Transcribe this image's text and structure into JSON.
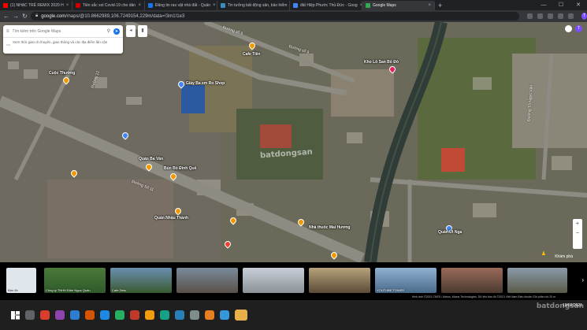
{
  "tabs": [
    {
      "label": "(1) NHẠC TRẺ REMIX 2020 H",
      "color": "#ff0000"
    },
    {
      "label": "Tiền sắc xoi Covid-19 cho dân",
      "color": "#cc0000"
    },
    {
      "label": "Đăng tin rao vặt nhà đất - Quản",
      "color": "#1a73e8"
    },
    {
      "label": "Tin tưởng bất động sản, bảo hiểm",
      "color": "#3c8dbc"
    },
    {
      "label": "đất Hiệp Phước Thủ Đức - Goog",
      "color": "#4285f4"
    },
    {
      "label": "Google Maps",
      "color": "#34a853"
    }
  ],
  "window": {
    "minimize": "—",
    "maximize": "☐",
    "close": "✕"
  },
  "address": {
    "host": "google.com",
    "path": "/maps/@10.8662989,106.7249154,229m/data=!3m1!1e3"
  },
  "search": {
    "placeholder": "Tìm kiếm trên Google Maps",
    "hint": "Xem thời gian di chuyển, giao thông và các địa điểm lân cận"
  },
  "profile_initial": "T",
  "places": [
    {
      "name": "Cafe Tiên",
      "type": "or"
    },
    {
      "name": "Giày Ba em Ro Shop",
      "type": "bl"
    },
    {
      "name": "Kho Lô San Bố Đỏ",
      "type": "pk"
    },
    {
      "name": "Cuộc Thường",
      "type": "or"
    },
    {
      "name": "Quán Ba Vân",
      "type": "or"
    },
    {
      "name": "Bún Bò Đình Quế",
      "type": "or"
    },
    {
      "name": "Quán Nhậu Thành",
      "type": "or"
    },
    {
      "name": "Nhà thuốc Mai Hương",
      "type": "or"
    },
    {
      "name": "Quán Út Nga",
      "type": "bl"
    },
    {
      "name": "Đường số 6",
      "type": "road"
    },
    {
      "name": "Đường số 9",
      "type": "road"
    },
    {
      "name": "Đường Số 11",
      "type": "road"
    },
    {
      "name": "Đường 12",
      "type": "road"
    },
    {
      "name": "Đường Tô Ngọc Vân",
      "type": "road"
    }
  ],
  "watermark": "batdongsan",
  "imagery": {
    "label_map": "Bản đồ",
    "thumbs": [
      {
        "cap": "Công ty TNHH Điện Ngọc Quân"
      },
      {
        "cap": "Cafe Zeta"
      },
      {
        "cap": ""
      },
      {
        "cap": ""
      },
      {
        "cap": ""
      },
      {
        "cap": "YOUTUBE TOWER"
      },
      {
        "cap": ""
      },
      {
        "cap": ""
      }
    ],
    "attribution": "Hình ảnh ©2021 CNES / Airbus, Maxar Technologies, Dữ liệu bản đồ ©2021   Việt Nam   Điều khoản   Gửi phản hồi   20 m",
    "explore": "Khám phá"
  },
  "taskbar": {
    "time": "19/02/2021",
    "watermark": "batdongsan"
  },
  "colors": {
    "accent": "#1a73e8",
    "road": "#8a8a82",
    "canal": "#3b4a45"
  }
}
